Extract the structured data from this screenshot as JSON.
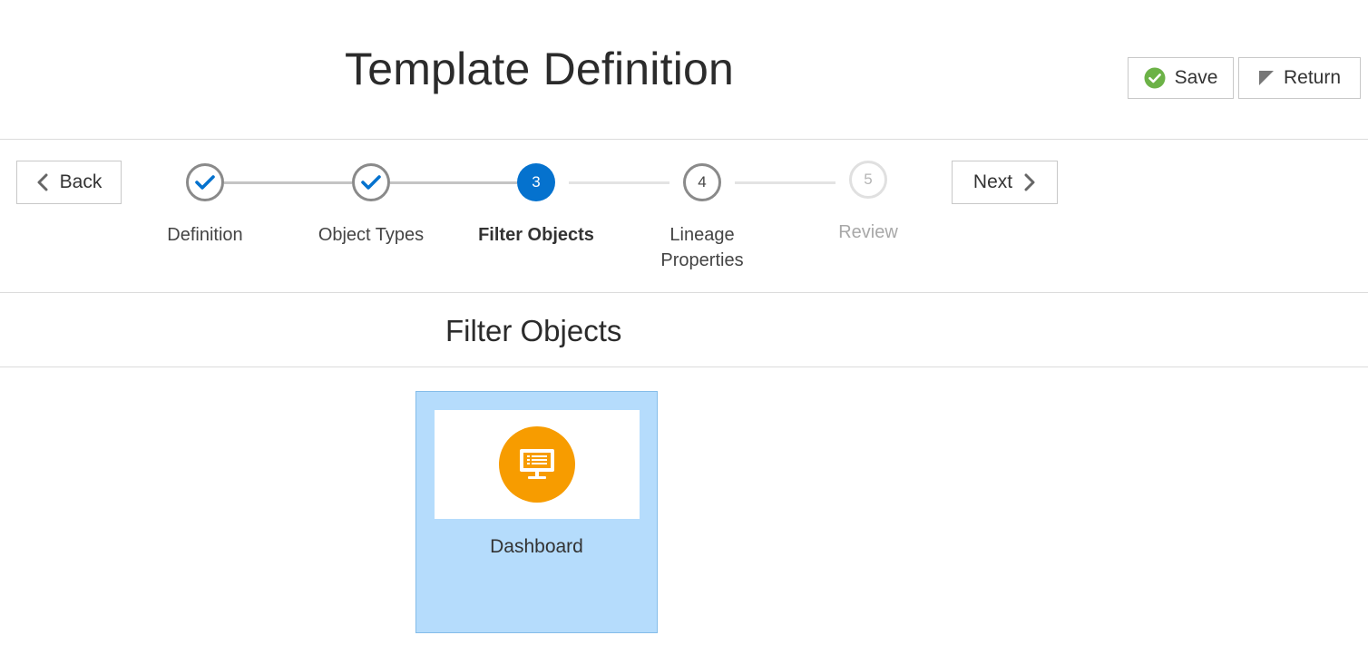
{
  "header": {
    "title": "Template Definition",
    "save_label": "Save",
    "return_label": "Return"
  },
  "train": {
    "back_label": "Back",
    "next_label": "Next",
    "steps": [
      {
        "label_line1": "Definition",
        "label_line2": "",
        "state": "done",
        "number": "1"
      },
      {
        "label_line1": "Object Types",
        "label_line2": "",
        "state": "done",
        "number": "2"
      },
      {
        "label_line1": "Filter Objects",
        "label_line2": "",
        "state": "current",
        "number": "3"
      },
      {
        "label_line1": "Lineage",
        "label_line2": "Properties",
        "state": "upcoming",
        "number": "4"
      },
      {
        "label_line1": "Review",
        "label_line2": "",
        "state": "disabled",
        "number": "5"
      }
    ]
  },
  "section": {
    "title": "Filter Objects"
  },
  "cards": [
    {
      "label": "Dashboard",
      "icon": "dashboard-monitor-icon",
      "selected": true
    }
  ],
  "colors": {
    "accent": "#0572ce",
    "card_selected_bg": "#b5dcfc",
    "dashboard_icon_bg": "#f79c00",
    "save_icon": "#6cb247"
  }
}
